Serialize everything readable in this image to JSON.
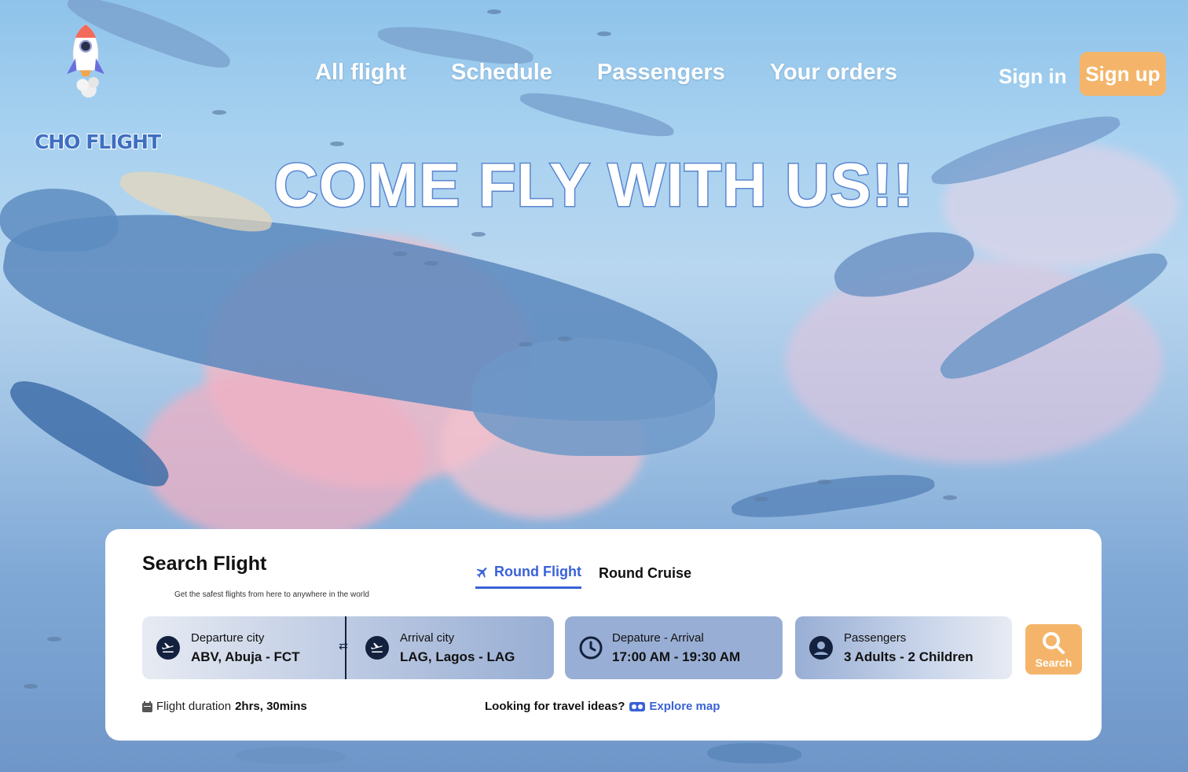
{
  "brand": {
    "name": "CHO FLIGHT"
  },
  "nav": {
    "items": [
      "All flight",
      "Schedule",
      "Passengers",
      "Your orders"
    ],
    "sign_in": "Sign in",
    "sign_up": "Sign up"
  },
  "hero": {
    "title": "COME FLY WITH US!!"
  },
  "search": {
    "title": "Search Flight",
    "subtitle": "Get the safest flights from here to anywhere in the world",
    "tabs": [
      {
        "label": "Round Flight",
        "active": true
      },
      {
        "label": "Round Cruise",
        "active": false
      }
    ],
    "departure": {
      "label": "Departure city",
      "value": "ABV, Abuja - FCT"
    },
    "arrival": {
      "label": "Arrival city",
      "value": "LAG, Lagos - LAG"
    },
    "time": {
      "label": "Depature - Arrival",
      "value": "17:00 AM - 19:30 AM"
    },
    "passengers": {
      "label": "Passengers",
      "value": "3 Adults - 2 Children"
    },
    "button": "Search",
    "duration_label": "Flight duration",
    "duration_value": "2hrs, 30mins",
    "ideas_label": "Looking for travel ideas?",
    "explore_label": "Explore map"
  },
  "colors": {
    "accent": "#f4b56b",
    "primary": "#3a62d6",
    "icon_dark": "#13213f"
  }
}
